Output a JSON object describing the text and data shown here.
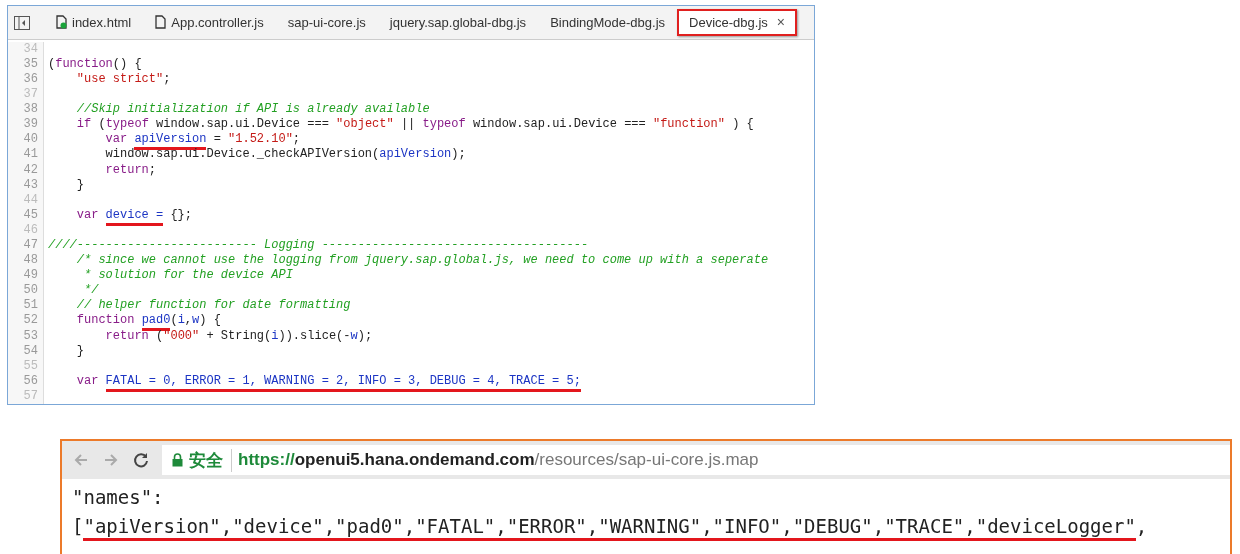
{
  "editor": {
    "tabs": [
      {
        "label": "index.html",
        "kind": "file",
        "modified": true,
        "selected": false
      },
      {
        "label": "App.controller.js",
        "kind": "file",
        "modified": false,
        "selected": false
      },
      {
        "label": "sap-ui-core.js",
        "kind": "plain",
        "modified": false,
        "selected": false
      },
      {
        "label": "jquery.sap.global-dbg.js",
        "kind": "plain",
        "modified": false,
        "selected": false
      },
      {
        "label": "BindingMode-dbg.js",
        "kind": "plain",
        "modified": false,
        "selected": false
      },
      {
        "label": "Device-dbg.js",
        "kind": "plain",
        "modified": false,
        "selected": true,
        "close": "×"
      }
    ],
    "lines": [
      {
        "number": "34"
      },
      {
        "number": "35",
        "tokens": [
          {
            "kind": "plain",
            "text": "("
          },
          {
            "kind": "keyword",
            "text": "function"
          },
          {
            "kind": "plain",
            "text": "() {"
          }
        ]
      },
      {
        "number": "36",
        "tokens": [
          {
            "kind": "string",
            "text": "    \"use strict\""
          },
          {
            "kind": "plain",
            "text": ";"
          }
        ]
      },
      {
        "number": "37"
      },
      {
        "number": "38",
        "tokens": [
          {
            "kind": "comment",
            "text": "    //Skip initialization if API is already available"
          }
        ]
      },
      {
        "number": "39",
        "tokens": [
          {
            "kind": "keyword",
            "text": "    if"
          },
          {
            "kind": "plain",
            "text": " ("
          },
          {
            "kind": "keyword",
            "text": "typeof"
          },
          {
            "kind": "plain",
            "text": " window.sap.ui.Device === "
          },
          {
            "kind": "string",
            "text": "\"object\""
          },
          {
            "kind": "plain",
            "text": " || "
          },
          {
            "kind": "keyword",
            "text": "typeof"
          },
          {
            "kind": "plain",
            "text": " window.sap.ui.Device === "
          },
          {
            "kind": "string",
            "text": "\"function\""
          },
          {
            "kind": "plain",
            "text": " ) {"
          }
        ]
      },
      {
        "number": "40",
        "tokens": [
          {
            "kind": "keyword",
            "text": "        var "
          },
          {
            "kind": "def",
            "text": "apiVersion",
            "marked": true
          },
          {
            "kind": "plain",
            "text": " = "
          },
          {
            "kind": "string",
            "text": "\"1.52.10\""
          },
          {
            "kind": "plain",
            "text": ";"
          }
        ]
      },
      {
        "number": "41",
        "tokens": [
          {
            "kind": "plain",
            "text": "        window.sap.ui.Device._checkAPIVersion("
          },
          {
            "kind": "def",
            "text": "apiVersion"
          },
          {
            "kind": "plain",
            "text": ");"
          }
        ]
      },
      {
        "number": "42",
        "tokens": [
          {
            "kind": "keyword",
            "text": "        return"
          },
          {
            "kind": "plain",
            "text": ";"
          }
        ]
      },
      {
        "number": "43",
        "tokens": [
          {
            "kind": "plain",
            "text": "    }"
          }
        ]
      },
      {
        "number": "44"
      },
      {
        "number": "45",
        "tokens": [
          {
            "kind": "keyword",
            "text": "    var "
          },
          {
            "kind": "def",
            "text": "device =",
            "marked": true
          },
          {
            "kind": "plain",
            "text": " {};"
          }
        ]
      },
      {
        "number": "46"
      },
      {
        "number": "47",
        "tokens": [
          {
            "kind": "comment",
            "text": "////------------------------- Logging -------------------------------------"
          }
        ]
      },
      {
        "number": "48",
        "tokens": [
          {
            "kind": "comment",
            "text": "    /* since we cannot use the logging from jquery.sap.global.js, we need to come up with a seperate"
          }
        ]
      },
      {
        "number": "49",
        "tokens": [
          {
            "kind": "comment",
            "text": "     * solution for the device API"
          }
        ]
      },
      {
        "number": "50",
        "tokens": [
          {
            "kind": "comment",
            "text": "     */"
          }
        ]
      },
      {
        "number": "51",
        "tokens": [
          {
            "kind": "comment",
            "text": "    // helper function for date formatting"
          }
        ]
      },
      {
        "number": "52",
        "tokens": [
          {
            "kind": "keyword",
            "text": "    function "
          },
          {
            "kind": "def",
            "text": "pad0",
            "marked": true
          },
          {
            "kind": "plain",
            "text": "("
          },
          {
            "kind": "def",
            "text": "i"
          },
          {
            "kind": "plain",
            "text": ","
          },
          {
            "kind": "def",
            "text": "w"
          },
          {
            "kind": "plain",
            "text": ") {"
          }
        ]
      },
      {
        "number": "53",
        "tokens": [
          {
            "kind": "keyword",
            "text": "        return"
          },
          {
            "kind": "plain",
            "text": " ("
          },
          {
            "kind": "string",
            "text": "\"000\""
          },
          {
            "kind": "plain",
            "text": " + String("
          },
          {
            "kind": "def",
            "text": "i"
          },
          {
            "kind": "plain",
            "text": ")).slice(-"
          },
          {
            "kind": "def",
            "text": "w"
          },
          {
            "kind": "plain",
            "text": ");"
          }
        ]
      },
      {
        "number": "54",
        "tokens": [
          {
            "kind": "plain",
            "text": "    }"
          }
        ]
      },
      {
        "number": "55"
      },
      {
        "number": "56",
        "tokens": [
          {
            "kind": "keyword",
            "text": "    var "
          },
          {
            "kind": "def",
            "text": "FATAL = 0, ERROR = 1, WARNING = 2, INFO = 3, DEBUG = 4, TRACE = 5;",
            "marked": true
          }
        ]
      },
      {
        "number": "57"
      }
    ]
  },
  "browser": {
    "security_label": "安全",
    "url_scheme": "https://",
    "url_host": "openui5.hana.ondemand.com",
    "url_path": "/resources/sap-ui-core.js.map",
    "lines": [
      {
        "tokens": [
          {
            "text": "\"names\":",
            "marked": false
          }
        ]
      },
      {
        "tokens": [
          {
            "text": "[",
            "marked": false
          },
          {
            "text": "\"apiVersion\",\"device\",\"pad0\",\"FATAL\",\"ERROR\",\"WARNING\",\"INFO\",\"DEBUG\",\"TRACE\",\"deviceLogger\"",
            "marked": true
          },
          {
            "text": ",",
            "marked": false
          }
        ]
      }
    ]
  }
}
